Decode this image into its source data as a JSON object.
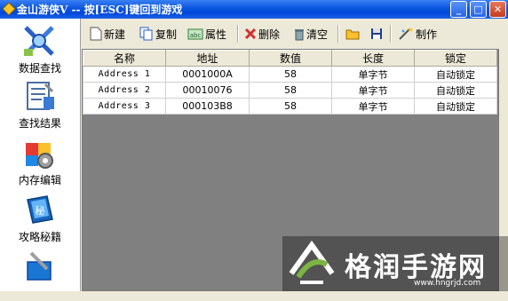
{
  "window": {
    "title": "金山游侠V -- 按[ESC]键回到游戏",
    "buttons": {
      "minimize": "_",
      "maximize": "□",
      "close": "✕"
    }
  },
  "sidebar": {
    "items": [
      {
        "label": "数据查找",
        "icon": "search-data-icon"
      },
      {
        "label": "查找结果",
        "icon": "search-results-icon"
      },
      {
        "label": "内存编辑",
        "icon": "memory-edit-icon"
      },
      {
        "label": "攻略秘籍",
        "icon": "guide-book-icon"
      },
      {
        "label": "",
        "icon": "tools-icon"
      }
    ]
  },
  "toolbar": {
    "new_label": "新建",
    "copy_label": "复制",
    "props_label": "属性",
    "delete_label": "删除",
    "clear_label": "清空",
    "make_label": "制作"
  },
  "table": {
    "columns": [
      "名称",
      "地址",
      "数值",
      "长度",
      "锁定"
    ],
    "rows": [
      [
        "Address 1",
        "0001000A",
        "58",
        "单字节",
        "自动锁定"
      ],
      [
        "Address 2",
        "00010076",
        "58",
        "单字节",
        "自动锁定"
      ],
      [
        "Address 3",
        "000103B8",
        "58",
        "单字节",
        "自动锁定"
      ]
    ]
  },
  "watermark": {
    "text": "格润手游网",
    "url": "www.hngrjd.com"
  },
  "colors": {
    "titlebar": "#0a55e0",
    "window_bg": "#ece9d8",
    "list_empty_bg": "#808080",
    "close_button": "#c33a1c"
  }
}
